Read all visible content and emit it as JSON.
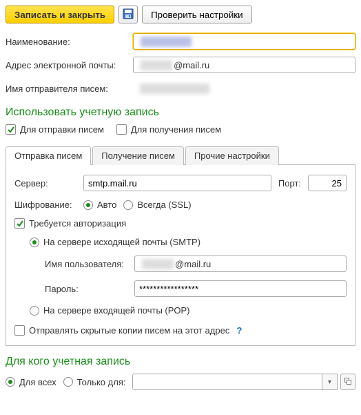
{
  "toolbar": {
    "save_close": "Записать и закрыть",
    "check_settings": "Проверить настройки"
  },
  "labels": {
    "name": "Наименование:",
    "email": "Адрес электронной почты:",
    "sender_name": "Имя отправителя писем:"
  },
  "fields": {
    "name_value": "████████",
    "email_prefix": "█████",
    "email_domain": "@mail.ru",
    "sender_value": "███████████"
  },
  "section_use_account": "Использовать учетную запись",
  "use_account": {
    "for_send": "Для отправки писем",
    "for_receive": "Для получения писем"
  },
  "tabs": {
    "send": "Отправка писем",
    "receive": "Получение писем",
    "other": "Прочие настройки"
  },
  "send_tab": {
    "server_label": "Сервер:",
    "server_value": "smtp.mail.ru",
    "port_label": "Порт:",
    "port_value": "25",
    "enc_label": "Шифрование:",
    "enc_auto": "Авто",
    "enc_always": "Всегда (SSL)",
    "auth_required": "Требуется авторизация",
    "auth_smtp": "На сервере исходящей почты (SMTP)",
    "user_label": "Имя пользователя:",
    "user_prefix": "█████",
    "user_domain": "@mail.ru",
    "pwd_label": "Пароль:",
    "pwd_value": "*****************",
    "auth_pop": "На сервере входящей почты (POP)",
    "bcc_label": "Отправлять скрытые копии писем на этот адрес"
  },
  "for_whom": {
    "header": "Для кого учетная запись",
    "all": "Для всех",
    "only": "Только для:"
  }
}
